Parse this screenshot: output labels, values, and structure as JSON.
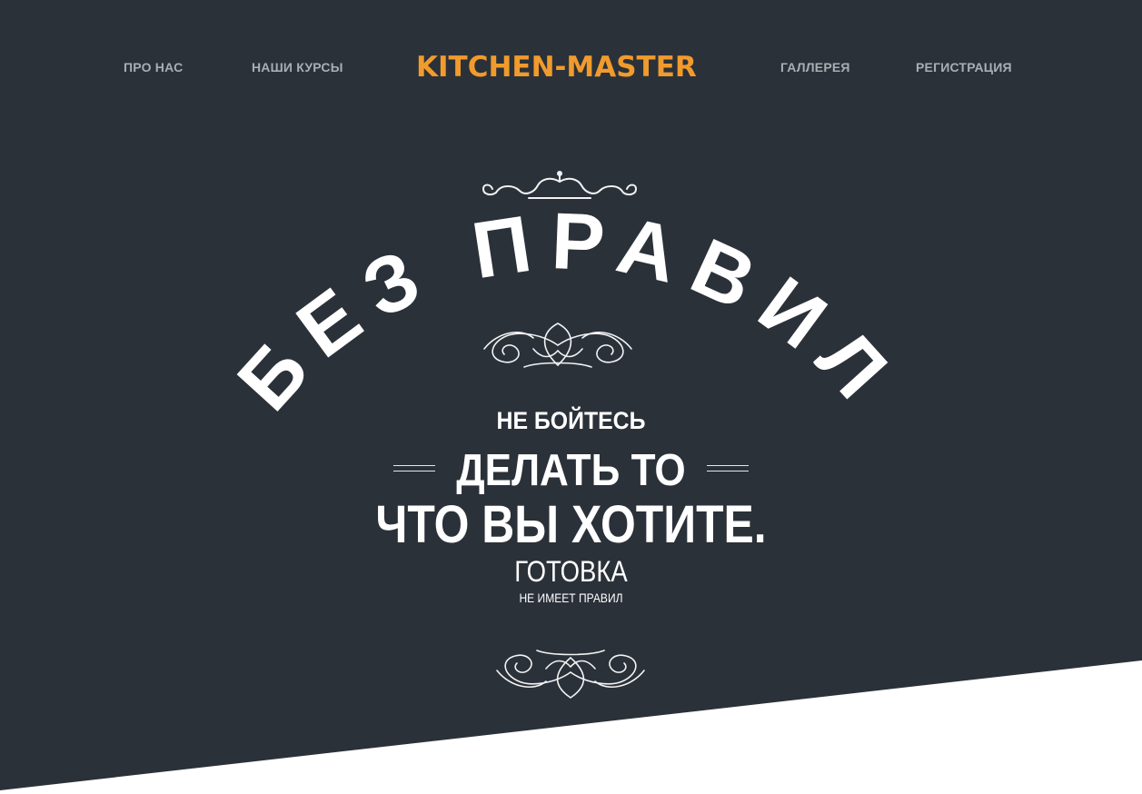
{
  "nav": {
    "about_label": "ПРО НАС",
    "courses_label": "НАШИ КУРСЫ",
    "logo_text": "KITCHEN-MASTER",
    "gallery_label": "ГАЛЛЕРЕЯ",
    "register_label": "РЕГИСТРАЦИЯ"
  },
  "hero": {
    "arc_title": "БЕЗ ПРАВИЛ",
    "line1": "НЕ БОЙТЕСЬ",
    "line2": "ДЕЛАТЬ ТО",
    "line3": "ЧТО ВЫ ХОТИТЕ.",
    "line4": "ГОТОВКА",
    "line5": "НЕ ИМЕЕТ ПРАВИЛ"
  },
  "colors": {
    "background": "#2b3139",
    "accent": "#f19b2c",
    "nav_text": "#a9aeb3",
    "hero_text": "#ffffff",
    "lower_section": "#ffffff"
  },
  "icons": {
    "top": "flourish-top-icon",
    "middle": "flourish-middle-icon",
    "bottom": "flourish-bottom-icon"
  }
}
